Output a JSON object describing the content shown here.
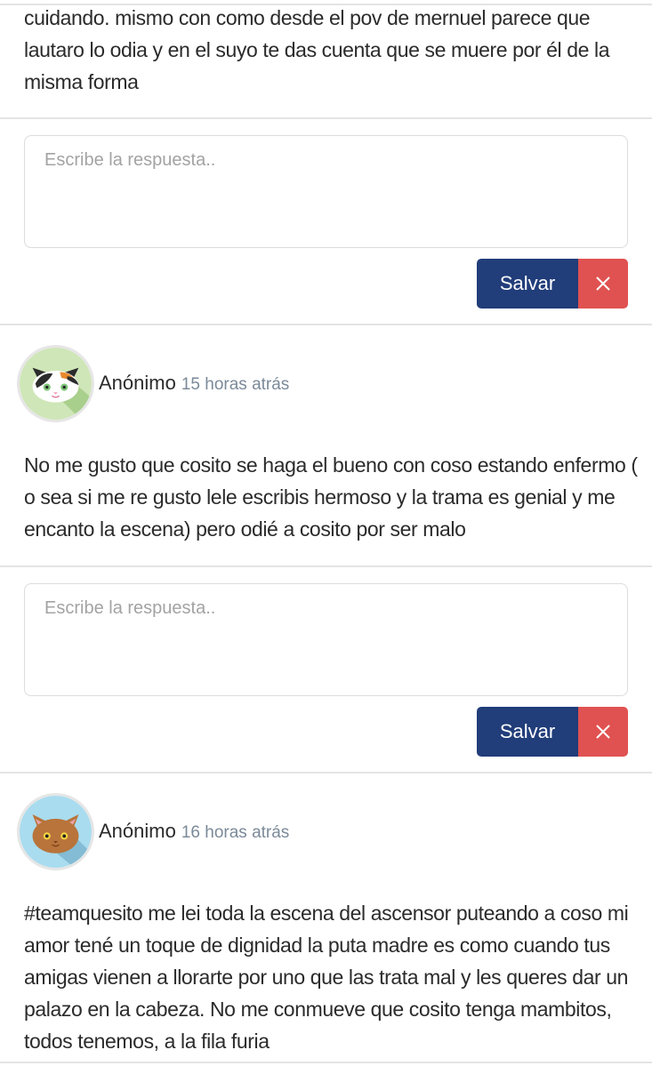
{
  "comments": [
    {
      "text": "cuidando. mismo con como desde el pov de mernuel parece que lautaro lo odia y en el suyo te das cuenta que se muere por él de la misma forma"
    },
    {
      "author": "Anónimo",
      "time": "15 horas atrás",
      "avatar_icon": "calico-cat-icon",
      "text": "No me gusto que cosito se haga el bueno con coso estando enfermo ( o sea si me re gusto lele escribis hermoso y la trama es genial y me encanto la escena) pero odié a cosito por ser malo"
    },
    {
      "author": "Anónimo",
      "time": "16 horas atrás",
      "avatar_icon": "brown-cat-icon",
      "text": "#teamquesito me lei toda la escena del ascensor puteando a coso mi amor tené un toque de dignidad la puta madre es como cuando tus amigas vienen a llorarte por uno que las trata mal y les queres dar un palazo en la cabeza. No me conmueve que cosito tenga mambitos, todos tenemos, a la fila furia"
    }
  ],
  "reply": {
    "placeholder": "Escribe la respuesta..",
    "save_label": "Salvar",
    "cancel_icon": "close-icon"
  },
  "colors": {
    "save": "#213d7a",
    "cancel": "#e05251",
    "time": "#7b8a99"
  }
}
